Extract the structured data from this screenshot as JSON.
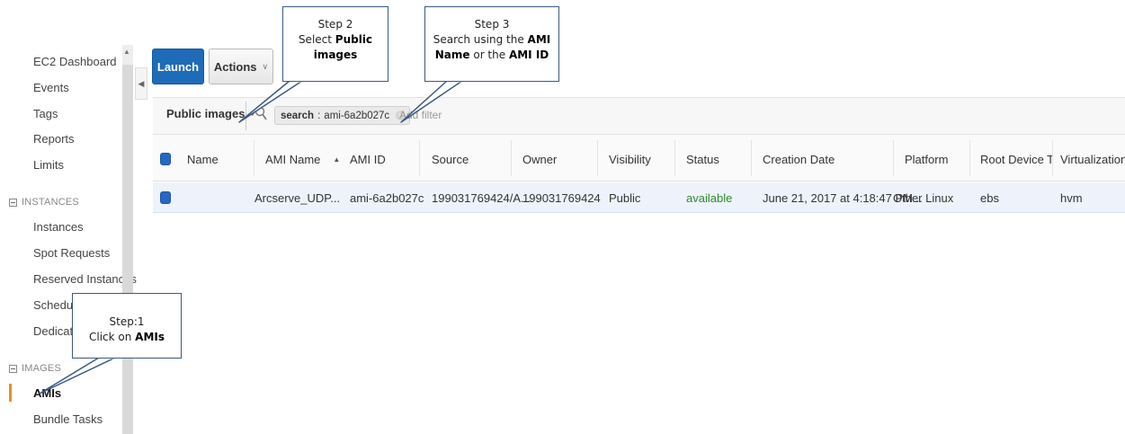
{
  "sidebar": {
    "items_top": [
      "EC2 Dashboard",
      "Events",
      "Tags",
      "Reports",
      "Limits"
    ],
    "instances_section": "INSTANCES",
    "instances_items": [
      "Instances",
      "Spot Requests",
      "Reserved Instances",
      "Scheduled I",
      "Dedicated H"
    ],
    "images_section": "IMAGES",
    "images_items": [
      "AMIs",
      "Bundle Tasks"
    ],
    "active_item": "AMIs"
  },
  "toolbar": {
    "launch_label": "Launch",
    "actions_label": "Actions"
  },
  "filter": {
    "selected_filter": "Public images",
    "token_key": "search",
    "token_sep": ":",
    "token_value": "ami-6a2b027c",
    "add_filter_placeholder": "Add filter"
  },
  "table": {
    "columns": [
      "Name",
      "AMI Name",
      "AMI ID",
      "Source",
      "Owner",
      "Visibility",
      "Status",
      "Creation Date",
      "Platform",
      "Root Device Ty",
      "Virtualization"
    ],
    "rows": [
      {
        "name": "",
        "ami_name": "Arcserve_UDP...",
        "ami_id": "ami-6a2b027c",
        "source": "199031769424/A...",
        "owner": "199031769424",
        "visibility": "Public",
        "status": "available",
        "creation_date": "June 21, 2017 at 4:18:47 PM...",
        "platform": "Other Linux",
        "root_device_type": "ebs",
        "virtualization": "hvm"
      }
    ]
  },
  "callouts": {
    "step1": {
      "line1": "Step:1",
      "pre": "Click on ",
      "bold": "AMIs"
    },
    "step2": {
      "line1": "Step 2",
      "pre": "Select ",
      "bold1": "Public",
      "bold2": "images"
    },
    "step3": {
      "line1": "Step 3",
      "line2_pre": "Search using the ",
      "line2_bold": "AMI",
      "line3_bold1": "Name",
      "line3_mid": " or the ",
      "line3_bold2": "AMI ID"
    }
  },
  "colors": {
    "primary_button": "#1e6bb8",
    "active_indicator": "#f08a24",
    "status_available": "#2e8b2e",
    "selected_row": "#eef3fb"
  }
}
